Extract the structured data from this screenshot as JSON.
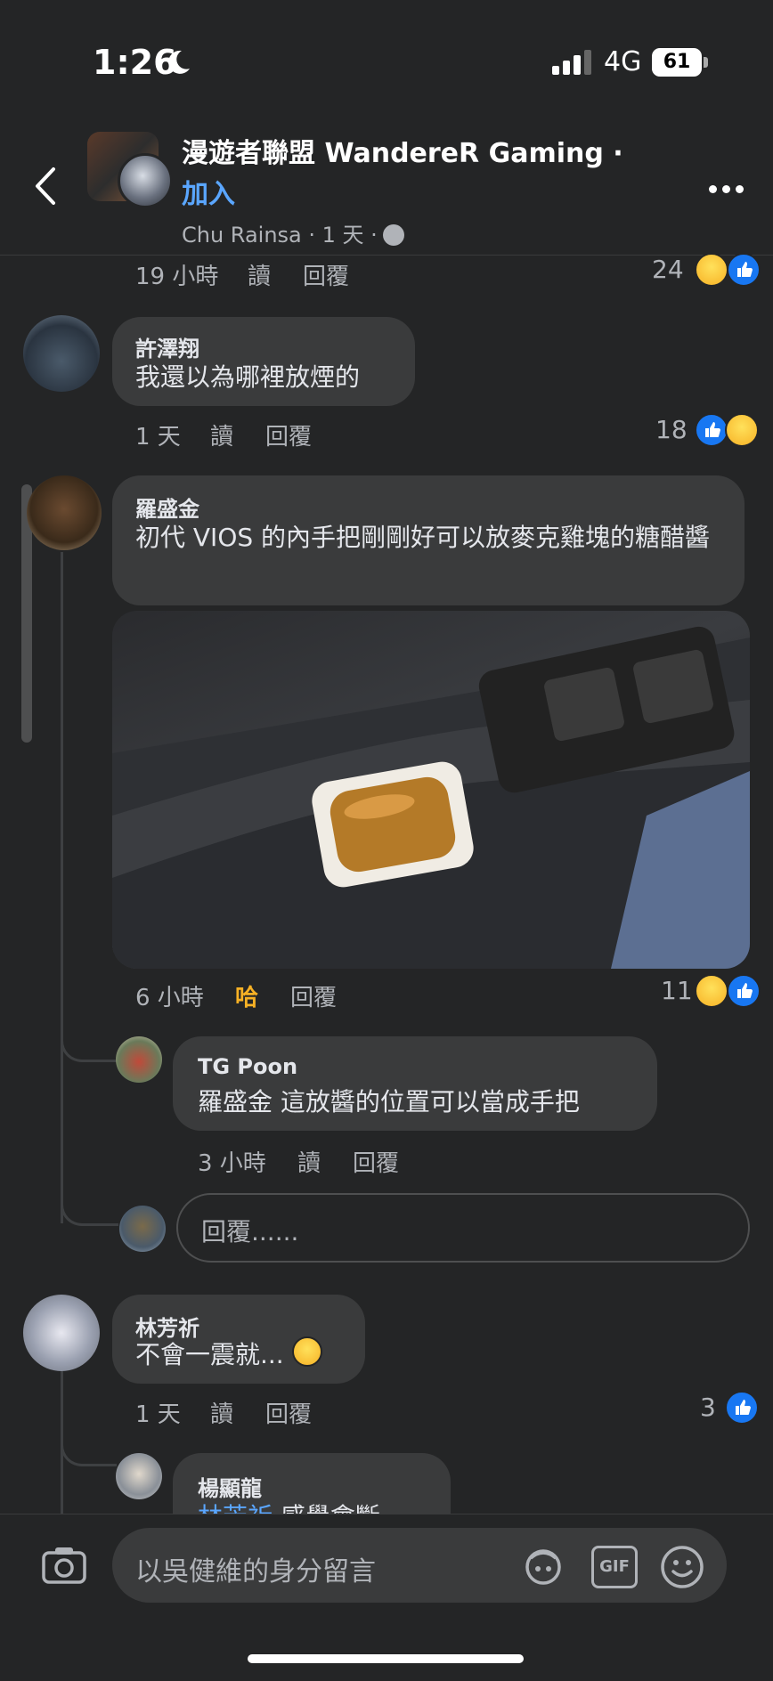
{
  "status": {
    "time": "1:26",
    "network": "4G",
    "battery": "61"
  },
  "header": {
    "title": "漫遊者聯盟 WandereR Gaming · ",
    "join": "加入",
    "meta": "Chu Rainsa · 1 天 ·"
  },
  "prev_comment": {
    "time": "19 小時",
    "read": "讀",
    "reply": "回覆",
    "count": "24"
  },
  "comments": [
    {
      "name": "許澤翔",
      "text": "我還以為哪裡放煙的",
      "time": "1 天",
      "read": "讀",
      "reply": "回覆",
      "count": "18"
    },
    {
      "name": "羅盛金",
      "text": "初代 VIOS 的內手把剛剛好可以放麥克雞塊的糖醋醬",
      "time": "6 小時",
      "reaction": "哈",
      "reply": "回覆",
      "count": "11"
    },
    {
      "name": "TG Poon",
      "text": "羅盛金 這放醬的位置可以當成手把",
      "time": "3 小時",
      "read": "讀",
      "reply": "回覆"
    },
    {
      "name": "林芳祈",
      "text": "不會一震就...",
      "time": "1 天",
      "read": "讀",
      "reply": "回覆",
      "count": "3"
    },
    {
      "name": "楊顯龍",
      "mention": "林芳祈",
      "text": "感覺會斷"
    }
  ],
  "reply_placeholder": "回覆......",
  "composer": {
    "placeholder": "以吳健維的身分留言",
    "gif": "GIF"
  },
  "colors": {
    "background": "#242526",
    "bubble": "#3a3b3c",
    "link": "#5aa6ff",
    "like": "#1877f2",
    "haha": "#f7b125",
    "haha_text": "#f7b125"
  }
}
